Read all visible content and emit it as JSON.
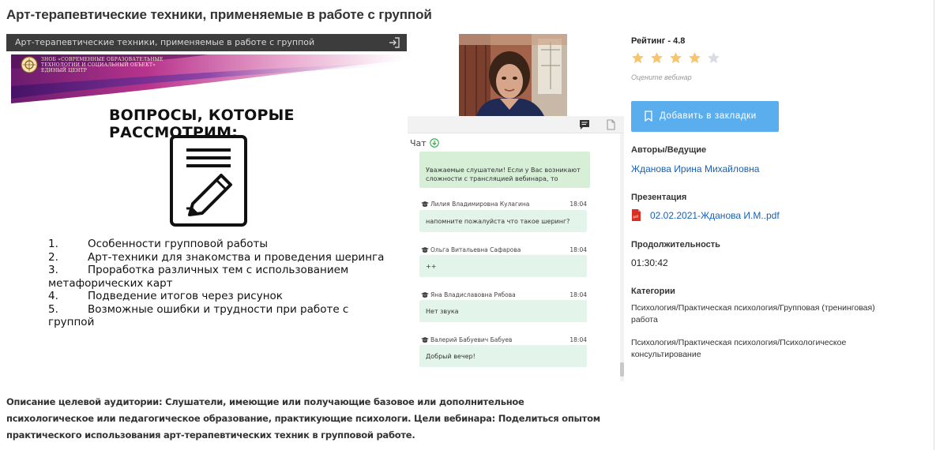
{
  "page": {
    "title": "Арт-терапевтические техники, применяемые в работе с группой"
  },
  "player": {
    "bar_title": "Арт-терапевтические техники, применяемые в работе с группой",
    "exit_icon": "exit-fullscreen-icon",
    "slide": {
      "org_line1": "ЗНОБ «СОВРЕМЕННЫЕ ОБРАЗОВАТЕЛЬНЫЕ",
      "org_line2": "ТЕХНОЛОГИИ И СОЦИАЛЬНЫЙ ОБЪЕКТ»",
      "org_line3": "ЕДИНЫЙ ЦЕНТР",
      "heading": "ВОПРОСЫ, КОТОРЫЕ РАССМОТРИМ:",
      "icon": "document-pencil-icon",
      "topics": [
        {
          "num": "1.",
          "text": "Особенности групповой работы"
        },
        {
          "num": "2.",
          "text": "Арт-техники для знакомства и проведения шеринга"
        },
        {
          "num": "3.",
          "text": "Проработка различных тем с использованием метафорических карт"
        },
        {
          "num": "4.",
          "text": "Подведение итогов через рисунок"
        },
        {
          "num": "5.",
          "text": "Возможные ошибки и трудности при работе с группой"
        }
      ]
    }
  },
  "chat": {
    "label": "Чат",
    "system_message": "Уважаемые слушатели! Если у Вас возникают сложности с трансляцией вебинара, то",
    "messages": [
      {
        "author": "Лилия Владимировна Кулагина",
        "time": "18:04",
        "text": "напомните пожалуйста что такое шеринг?"
      },
      {
        "author": "Ольга Витальевна Сафарова",
        "time": "18:04",
        "text": "++"
      },
      {
        "author": "Яна Владиславовна Рябова",
        "time": "18:04",
        "text": "Нет звука"
      },
      {
        "author": "Валерий Бабуевич Бабуев",
        "time": "18:04",
        "text": "Добрый вечер!"
      }
    ]
  },
  "info": {
    "rating_label": "Рейтинг - 4.8",
    "rating_value": 4.8,
    "stars_total": 5,
    "stars_filled": 4,
    "star_color": "#f7c56b",
    "star_empty_color": "#d9dde2",
    "rate_hint": "Оцените вебинар",
    "bookmark_button": "Добавить в закладки",
    "bookmark_color": "#5aaeee",
    "authors_label": "Авторы/Ведущие",
    "author": "Жданова Ирина Михайловна",
    "presentation_label": "Презентация",
    "presentation_file": "02.02.2021-Жданова И.М..pdf",
    "duration_label": "Продолжительность",
    "duration": "01:30:42",
    "categories_label": "Категории",
    "categories": [
      "Психология/Практическая психология/Групповая (тренинговая) работа",
      "Психология/Практическая психология/Психологическое консультирование"
    ]
  },
  "description": "Описание целевой аудитории: Слушатели, имеющие или получающие базовое или дополнительное психологическое или педагогическое образование, практикующие психологи. Цели вебинара: Поделиться опытом практического использования арт-терапевтических техник в групповой работе."
}
